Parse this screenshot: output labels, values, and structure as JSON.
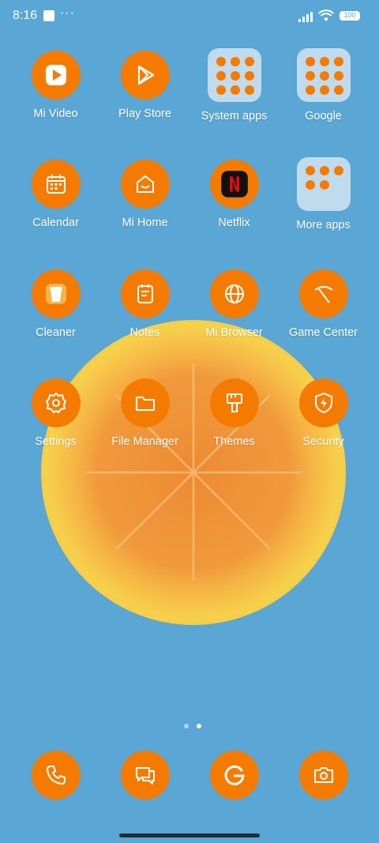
{
  "status": {
    "time": "8:16",
    "dots": "···",
    "battery": "100"
  },
  "apps": [
    {
      "label": "Mi Video",
      "icon": "mi-video-icon"
    },
    {
      "label": "Play Store",
      "icon": "play-store-icon"
    },
    {
      "label": "System apps",
      "icon": "folder-icon"
    },
    {
      "label": "Google",
      "icon": "folder-icon"
    },
    {
      "label": "Calendar",
      "icon": "calendar-icon"
    },
    {
      "label": "Mi Home",
      "icon": "mi-home-icon"
    },
    {
      "label": "Netflix",
      "icon": "netflix-icon"
    },
    {
      "label": "More apps",
      "icon": "folder-icon"
    },
    {
      "label": "Cleaner",
      "icon": "trash-icon"
    },
    {
      "label": "Notes",
      "icon": "notes-icon"
    },
    {
      "label": "Mi Browser",
      "icon": "globe-icon"
    },
    {
      "label": "Game Center",
      "icon": "game-center-icon"
    },
    {
      "label": "Settings",
      "icon": "gear-icon"
    },
    {
      "label": "File Manager",
      "icon": "folder-outline-icon"
    },
    {
      "label": "Themes",
      "icon": "brush-icon"
    },
    {
      "label": "Security",
      "icon": "shield-icon"
    }
  ],
  "dock": [
    {
      "name": "phone",
      "icon": "phone-icon"
    },
    {
      "name": "messages",
      "icon": "chat-icon"
    },
    {
      "name": "google",
      "icon": "google-g-icon"
    },
    {
      "name": "camera",
      "icon": "camera-icon"
    }
  ],
  "page_indicator": {
    "count": 2,
    "active": 2
  },
  "colors": {
    "background": "#5aa6d4",
    "icon": "#f57b00"
  }
}
